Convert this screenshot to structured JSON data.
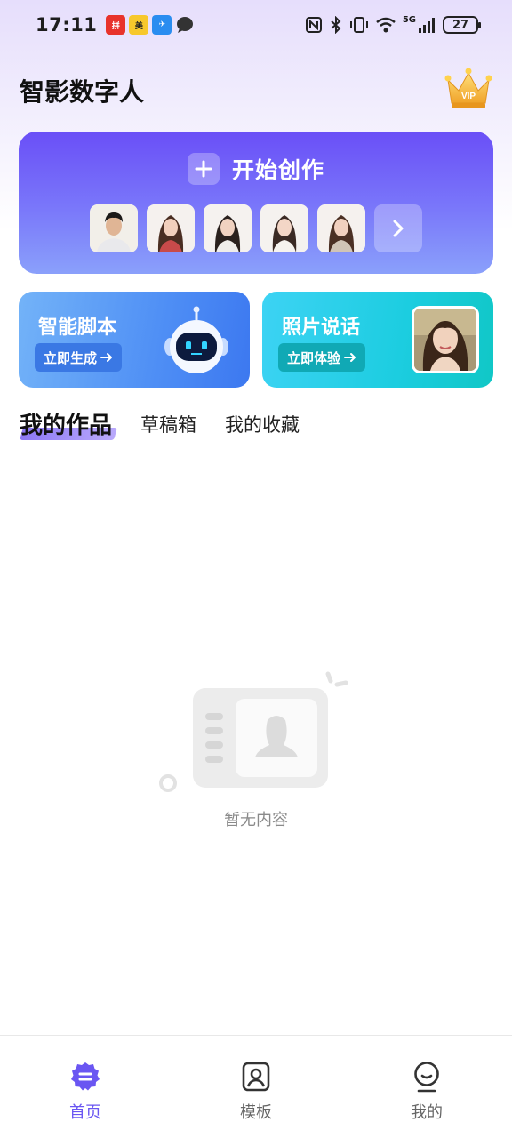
{
  "status_bar": {
    "time": "17:11",
    "battery": "27",
    "network": "5G"
  },
  "header": {
    "title": "智影数字人",
    "vip_badge": "VIP"
  },
  "create": {
    "label": "开始创作"
  },
  "features": [
    {
      "title": "智能脚本",
      "button": "立即生成"
    },
    {
      "title": "照片说话",
      "button": "立即体验"
    }
  ],
  "tabs": [
    {
      "label": "我的作品",
      "active": true
    },
    {
      "label": "草稿箱",
      "active": false
    },
    {
      "label": "我的收藏",
      "active": false
    }
  ],
  "empty_state": {
    "text": "暂无内容"
  },
  "nav": [
    {
      "label": "首页",
      "icon": "home-icon",
      "active": true
    },
    {
      "label": "模板",
      "icon": "template-icon",
      "active": false
    },
    {
      "label": "我的",
      "icon": "profile-icon",
      "active": false
    }
  ],
  "colors": {
    "accent": "#6a56f2",
    "create_gradient_top": "#6a4ff7",
    "create_gradient_bottom": "#8aa0fb",
    "script_card": "#4f8ff5",
    "photo_card": "#1ccde0"
  }
}
